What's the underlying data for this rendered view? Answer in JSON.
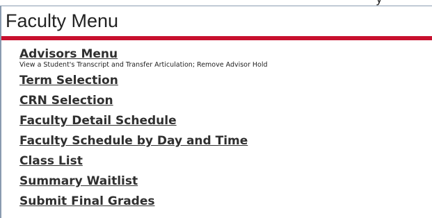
{
  "header": {
    "title": "Faculty Menu"
  },
  "menu": {
    "items": [
      {
        "label": "Advisors Menu",
        "description": "View a Student's Transcript and Transfer Articulation; Remove Advisor Hold"
      },
      {
        "label": "Term Selection"
      },
      {
        "label": "CRN Selection"
      },
      {
        "label": "Faculty Detail Schedule"
      },
      {
        "label": "Faculty Schedule by Day and Time"
      },
      {
        "label": "Class List"
      },
      {
        "label": "Summary Waitlist"
      },
      {
        "label": "Submit Final Grades"
      }
    ]
  },
  "colors": {
    "accent_rule": "#c8102e",
    "link_text": "#2f2f2f"
  }
}
